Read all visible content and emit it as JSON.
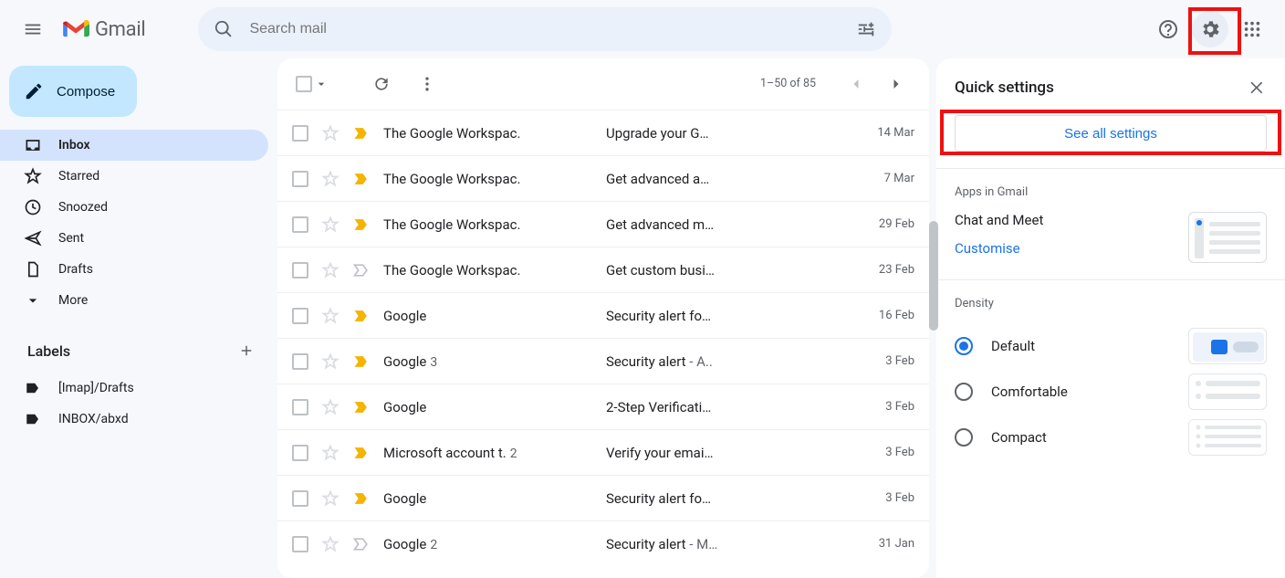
{
  "header": {
    "product": "Gmail",
    "search_placeholder": "Search mail"
  },
  "compose_label": "Compose",
  "nav": [
    {
      "id": "inbox",
      "label": "Inbox",
      "icon": "inbox",
      "active": true
    },
    {
      "id": "starred",
      "label": "Starred",
      "icon": "star",
      "active": false
    },
    {
      "id": "snoozed",
      "label": "Snoozed",
      "icon": "clock",
      "active": false
    },
    {
      "id": "sent",
      "label": "Sent",
      "icon": "send",
      "active": false
    },
    {
      "id": "drafts",
      "label": "Drafts",
      "icon": "file",
      "active": false
    },
    {
      "id": "more",
      "label": "More",
      "icon": "chevron",
      "active": false
    }
  ],
  "labels_header": "Labels",
  "labels": [
    {
      "label": "[Imap]/Drafts"
    },
    {
      "label": "INBOX/abxd"
    }
  ],
  "list": {
    "range_text": "1–50 of 85",
    "rows": [
      {
        "sender": "The Google Workspac.",
        "count": "",
        "subject": "Upgrade your G…",
        "tail": "",
        "date": "14 Mar",
        "important": true
      },
      {
        "sender": "The Google Workspac.",
        "count": "",
        "subject": "Get advanced a…",
        "tail": "",
        "date": "7 Mar",
        "important": true
      },
      {
        "sender": "The Google Workspac.",
        "count": "",
        "subject": "Get advanced m…",
        "tail": "",
        "date": "29 Feb",
        "important": true
      },
      {
        "sender": "The Google Workspac.",
        "count": "",
        "subject": "Get custom busi…",
        "tail": "",
        "date": "23 Feb",
        "important": false
      },
      {
        "sender": "Google",
        "count": "",
        "subject": "Security alert fo…",
        "tail": "",
        "date": "16 Feb",
        "important": true
      },
      {
        "sender": "Google",
        "count": "3",
        "subject": "Security alert",
        "tail": " - A..",
        "date": "3 Feb",
        "important": true
      },
      {
        "sender": "Google",
        "count": "",
        "subject": "2-Step Verificati…",
        "tail": "",
        "date": "3 Feb",
        "important": true
      },
      {
        "sender": "Microsoft account t.",
        "count": "2",
        "subject": "Verify your emai…",
        "tail": "",
        "date": "3 Feb",
        "important": true
      },
      {
        "sender": "Google",
        "count": "",
        "subject": "Security alert fo…",
        "tail": "",
        "date": "3 Feb",
        "important": true
      },
      {
        "sender": "Google",
        "count": "2",
        "subject": "Security alert",
        "tail": " - M…",
        "date": "31 Jan",
        "important": false
      }
    ]
  },
  "settings": {
    "title": "Quick settings",
    "see_all": "See all settings",
    "apps_section": "Apps in Gmail",
    "apps_label": "Chat and Meet",
    "customise": "Customise",
    "density_section": "Density",
    "density_options": [
      {
        "label": "Default",
        "checked": true
      },
      {
        "label": "Comfortable",
        "checked": false
      },
      {
        "label": "Compact",
        "checked": false
      }
    ]
  }
}
